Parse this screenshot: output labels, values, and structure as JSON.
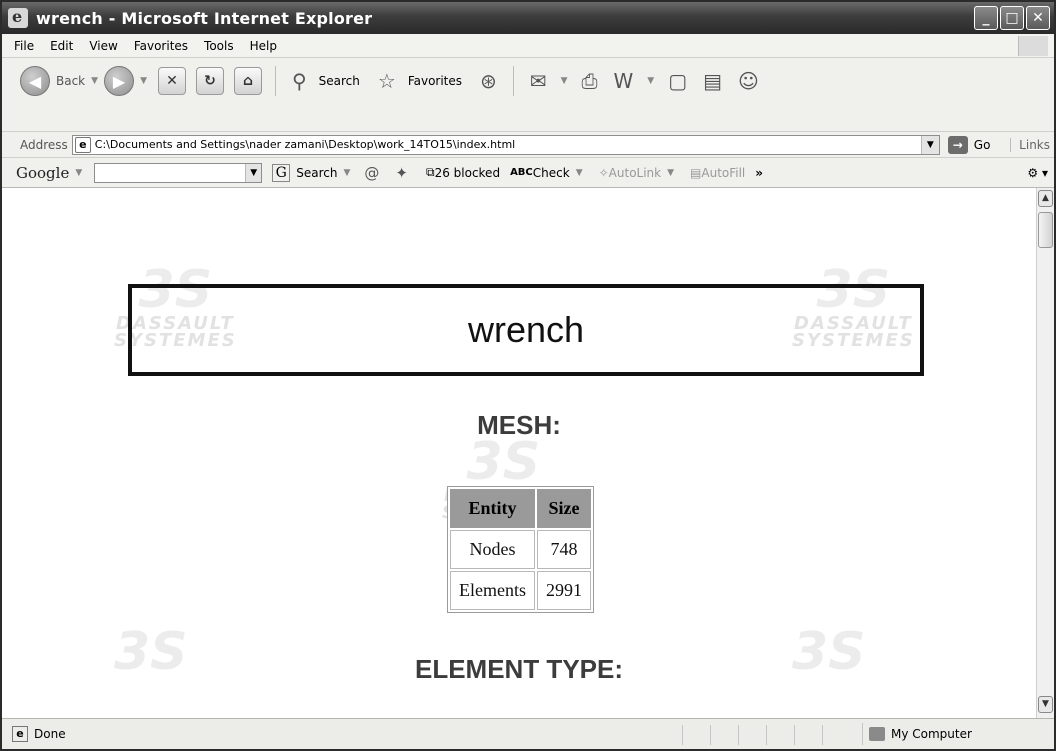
{
  "window": {
    "title": "wrench - Microsoft Internet Explorer"
  },
  "menu": [
    "File",
    "Edit",
    "View",
    "Favorites",
    "Tools",
    "Help"
  ],
  "toolbar": {
    "back_label": "Back",
    "search_label": "Search",
    "favorites_label": "Favorites"
  },
  "address": {
    "label": "Address",
    "url": "C:\\Documents and Settings\\nader zamani\\Desktop\\work_14TO15\\index.html",
    "go_label": "Go",
    "links_label": "Links"
  },
  "google": {
    "logo": "Google",
    "search_label": "Search",
    "blocked_label": "26 blocked",
    "check_label": "Check",
    "autolink_label": "AutoLink",
    "autofill_label": "AutoFill",
    "more_label": "»"
  },
  "page": {
    "title": "wrench",
    "mesh_heading": "MESH:",
    "element_type_heading": "ELEMENT TYPE:",
    "mesh_table": {
      "headers": [
        "Entity",
        "Size"
      ],
      "rows": [
        [
          "Nodes",
          "748"
        ],
        [
          "Elements",
          "2991"
        ]
      ]
    }
  },
  "status": {
    "text": "Done",
    "zone": "My Computer"
  }
}
